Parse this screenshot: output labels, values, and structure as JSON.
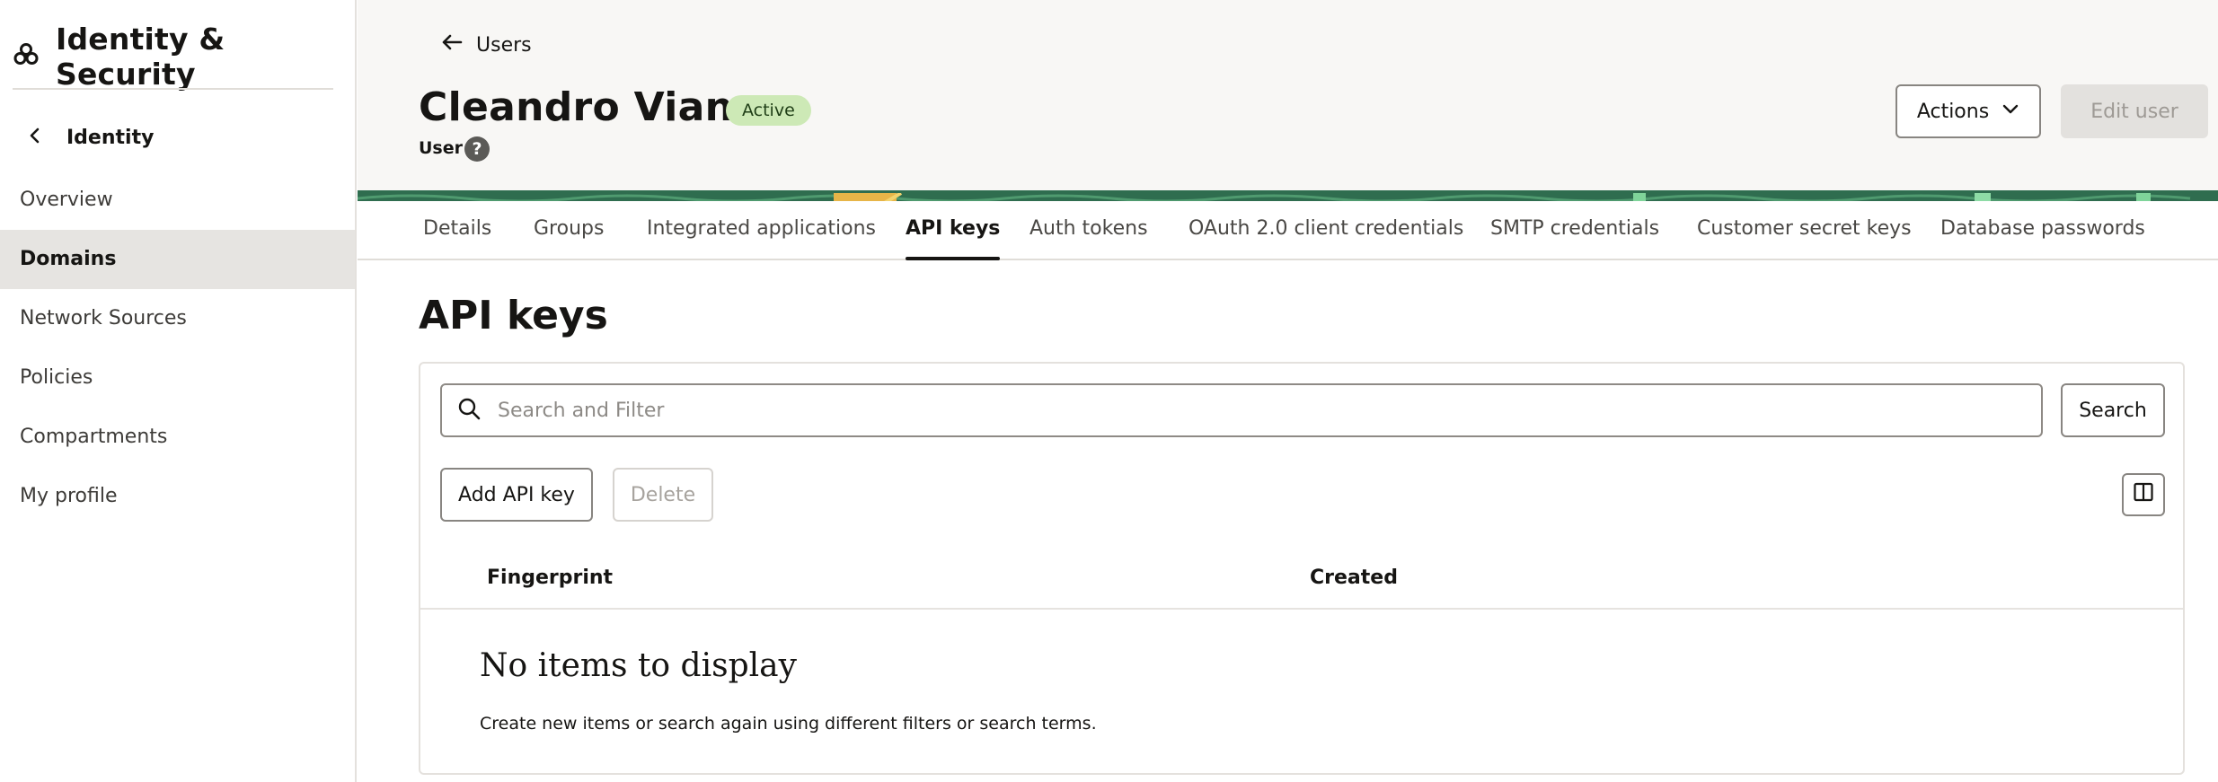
{
  "sidebar": {
    "app_title": "Identity & Security",
    "back_label": "Identity",
    "items": [
      {
        "label": "Overview",
        "selected": false
      },
      {
        "label": "Domains",
        "selected": true
      },
      {
        "label": "Network Sources",
        "selected": false
      },
      {
        "label": "Policies",
        "selected": false
      },
      {
        "label": "Compartments",
        "selected": false
      },
      {
        "label": "My profile",
        "selected": false
      }
    ]
  },
  "header": {
    "back_label": "Users",
    "user_name": "Cleandro Viana",
    "status": "Active",
    "user_type": "User",
    "help_glyph": "?",
    "actions_label": "Actions",
    "edit_label": "Edit user"
  },
  "tabs": [
    {
      "label": "Details",
      "active": false
    },
    {
      "label": "Groups",
      "active": false
    },
    {
      "label": "Integrated applications",
      "active": false
    },
    {
      "label": "API keys",
      "active": true
    },
    {
      "label": "Auth tokens",
      "active": false
    },
    {
      "label": "OAuth 2.0 client credentials",
      "active": false
    },
    {
      "label": "SMTP credentials",
      "active": false
    },
    {
      "label": "Customer secret keys",
      "active": false
    },
    {
      "label": "Database passwords",
      "active": false
    }
  ],
  "main": {
    "title": "API keys",
    "search": {
      "placeholder": "Search and Filter",
      "button_label": "Search"
    },
    "add_label": "Add API key",
    "delete_label": "Delete",
    "columns": [
      "Fingerprint",
      "Created"
    ],
    "empty_title": "No items to display",
    "empty_message": "Create new items or search again using different filters or search terms."
  },
  "colors": {
    "status_badge_bg": "#cde9b6",
    "selected_nav_bg": "#e6e4e1",
    "banner_green": "#2f6d4f"
  },
  "icons": [
    "identity-logo-icon",
    "chevron-left-icon",
    "arrow-left-icon",
    "help-icon",
    "chevron-down-icon",
    "search-icon",
    "columns-icon"
  ]
}
